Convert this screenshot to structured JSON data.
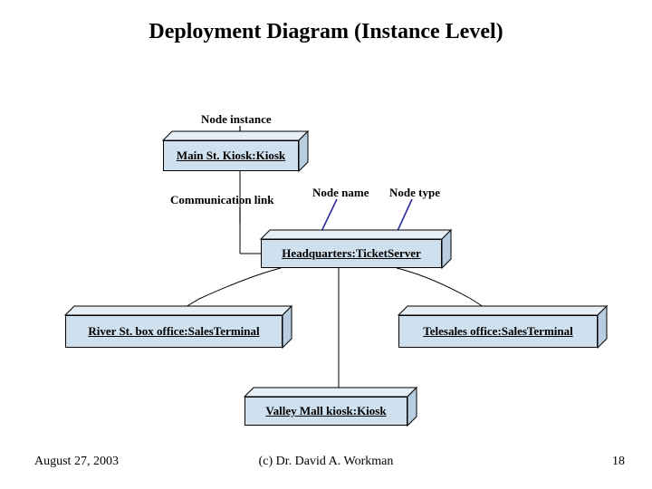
{
  "title": "Deployment Diagram (Instance Level)",
  "labels": {
    "node_instance": "Node instance",
    "communication_link": "Communication link",
    "node_name": "Node name",
    "node_type": "Node type"
  },
  "nodes": {
    "main_kiosk": "Main St. Kiosk:Kiosk",
    "headquarters": "Headquarters:TicketServer",
    "river_office": "River St. box office:SalesTerminal",
    "telesales": "Telesales office:SalesTerminal",
    "valley_mall": "Valley Mall kiosk:Kiosk"
  },
  "footer": {
    "date": "August 27, 2003",
    "copyright": "(c) Dr. David A. Workman",
    "page": "18"
  }
}
